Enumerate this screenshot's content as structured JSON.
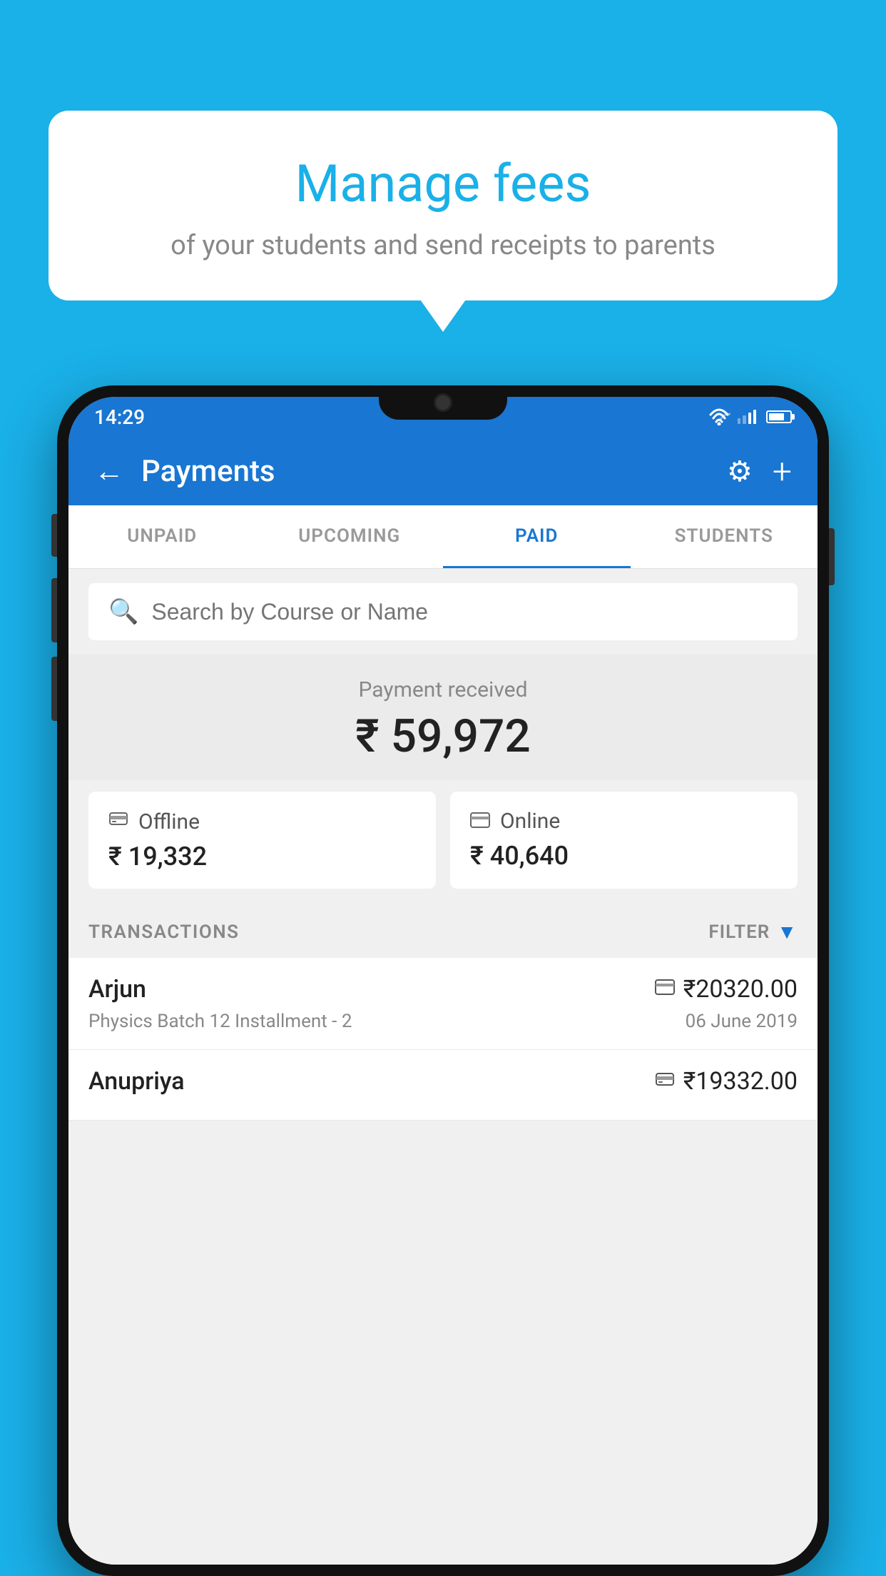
{
  "background_color": "#1ab0e8",
  "bubble": {
    "title": "Manage fees",
    "subtitle": "of your students and send receipts to parents"
  },
  "status_bar": {
    "time": "14:29",
    "wifi": "▼",
    "battery_level": 65
  },
  "header": {
    "title": "Payments",
    "back_label": "←",
    "gear_label": "⚙",
    "plus_label": "+"
  },
  "tabs": [
    {
      "label": "UNPAID",
      "active": false
    },
    {
      "label": "UPCOMING",
      "active": false
    },
    {
      "label": "PAID",
      "active": true
    },
    {
      "label": "STUDENTS",
      "active": false
    }
  ],
  "search": {
    "placeholder": "Search by Course or Name"
  },
  "payment_received": {
    "label": "Payment received",
    "amount": "₹ 59,972"
  },
  "payment_cards": [
    {
      "type": "Offline",
      "amount": "₹ 19,332",
      "icon": "💵"
    },
    {
      "type": "Online",
      "amount": "₹ 40,640",
      "icon": "💳"
    }
  ],
  "transactions": {
    "label": "TRANSACTIONS",
    "filter_label": "FILTER",
    "rows": [
      {
        "name": "Arjun",
        "course": "Physics Batch 12 Installment - 2",
        "amount": "₹20320.00",
        "date": "06 June 2019",
        "type_icon": "💳"
      },
      {
        "name": "Anupriya",
        "course": "",
        "amount": "₹19332.00",
        "date": "",
        "type_icon": "💵"
      }
    ]
  }
}
